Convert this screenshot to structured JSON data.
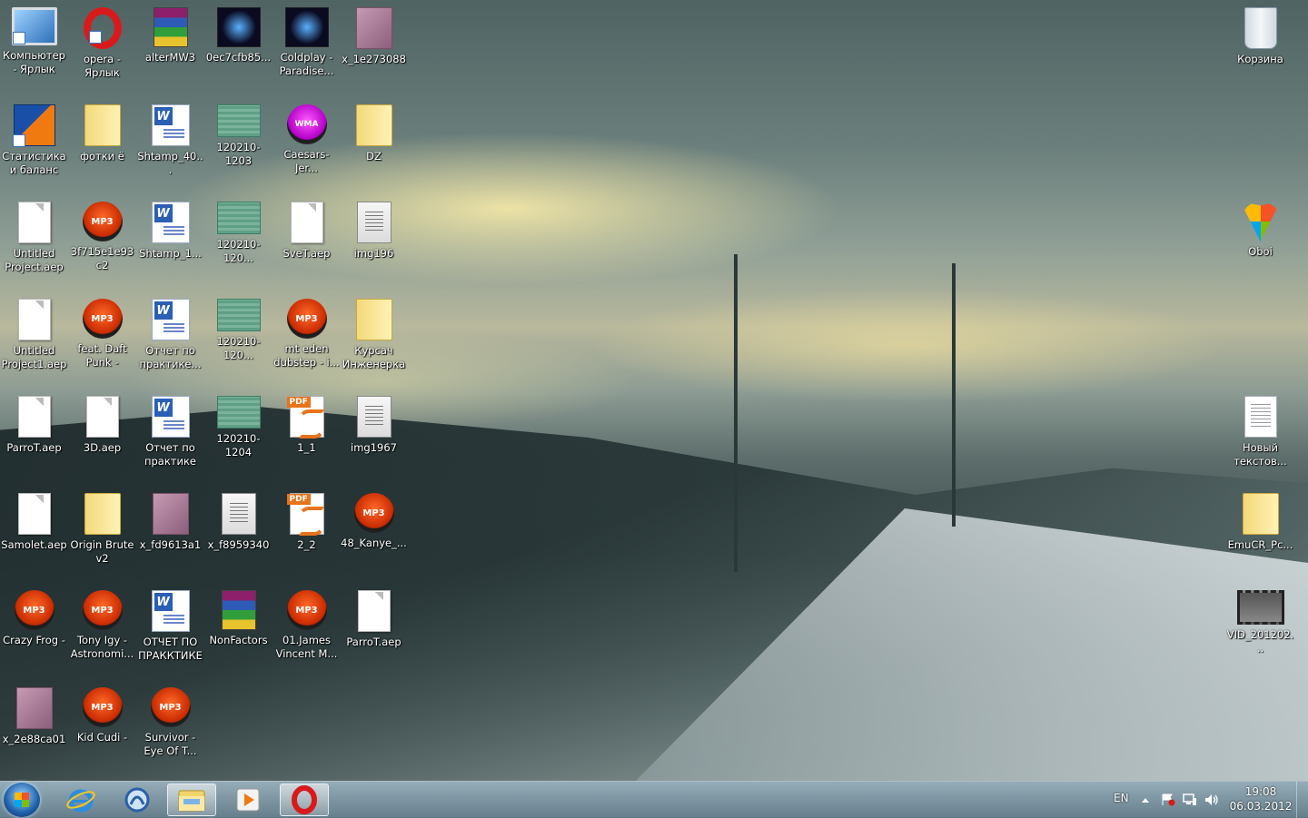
{
  "desktop": {
    "icons": [
      {
        "label": "Компьютер - Ярлык",
        "icon": "computer-icon"
      },
      {
        "label": "opera - Ярлык",
        "icon": "opera-icon"
      },
      {
        "label": "alterMW3",
        "icon": "winrar-icon"
      },
      {
        "label": "0ec7cfb85...",
        "icon": "media-file-icon"
      },
      {
        "label": "Coldplay - Paradise...",
        "icon": "media-file-icon"
      },
      {
        "label": "x_1e273088",
        "icon": "photo-icon"
      },
      {
        "label": "Статистика и баланс",
        "icon": "statistics-icon"
      },
      {
        "label": "фотки ё",
        "icon": "folder-icon"
      },
      {
        "label": "Shtamp_40...",
        "icon": "word-doc-icon"
      },
      {
        "label": "120210-1203",
        "icon": "excel-sheet-icon"
      },
      {
        "label": "Caesars-Jer...",
        "icon": "wma-icon"
      },
      {
        "label": "DZ",
        "icon": "folder-icon"
      },
      {
        "label": "Untitled Project.aep",
        "icon": "blank-file-icon"
      },
      {
        "label": "3f715e1e93c2",
        "icon": "mp3-icon"
      },
      {
        "label": "Shtamp_1...",
        "icon": "word-doc-icon"
      },
      {
        "label": "120210-120...",
        "icon": "excel-sheet-icon"
      },
      {
        "label": "SveT.aep",
        "icon": "blank-file-icon"
      },
      {
        "label": "img196",
        "icon": "scan-image-icon"
      },
      {
        "label": "Untitled Project1.aep",
        "icon": "blank-file-icon"
      },
      {
        "label": "feat. Daft Punk -",
        "icon": "mp3-icon"
      },
      {
        "label": "Отчет по практике...",
        "icon": "word-doc-icon"
      },
      {
        "label": "120210-120...",
        "icon": "excel-sheet-icon"
      },
      {
        "label": "mt eden dubstep - i...",
        "icon": "mp3-icon"
      },
      {
        "label": "Курсач Инженерка",
        "icon": "folder-icon"
      },
      {
        "label": "ParroT.aep",
        "icon": "blank-file-icon"
      },
      {
        "label": "3D.aep",
        "icon": "blank-file-icon"
      },
      {
        "label": "Отчет по практике",
        "icon": "word-doc-icon"
      },
      {
        "label": "120210-1204",
        "icon": "excel-sheet-icon"
      },
      {
        "label": "1_1",
        "icon": "pdf-icon"
      },
      {
        "label": "img1967",
        "icon": "scan-image-icon"
      },
      {
        "label": "Samolet.aep",
        "icon": "blank-file-icon"
      },
      {
        "label": "Origin Brute v2",
        "icon": "folder-icon"
      },
      {
        "label": "x_fd9613a1",
        "icon": "photo-icon"
      },
      {
        "label": "x_f8959340",
        "icon": "scan-image-icon"
      },
      {
        "label": "2_2",
        "icon": "pdf-icon"
      },
      {
        "label": "48_Kanye_...",
        "icon": "mp3-icon"
      },
      {
        "label": "Crazy Frog -",
        "icon": "mp3-icon"
      },
      {
        "label": "Tony Igy - Astronomi...",
        "icon": "mp3-icon"
      },
      {
        "label": "ОТЧЕТ ПО ПРАККТИКЕ",
        "icon": "word-doc-icon"
      },
      {
        "label": "NonFactors",
        "icon": "winrar-icon"
      },
      {
        "label": "01.James Vincent M...",
        "icon": "mp3-icon"
      },
      {
        "label": "ParroT.aep",
        "icon": "blank-file-icon"
      },
      {
        "label": "x_2e88ca01",
        "icon": "photo-icon"
      },
      {
        "label": "Kid Cudi -",
        "icon": "mp3-icon"
      },
      {
        "label": "Survivor - Eye Of T...",
        "icon": "mp3-icon"
      },
      {
        "label": "Корзина",
        "icon": "recycle-bin-icon"
      },
      {
        "label": "Oboi",
        "icon": "oboi-icon"
      },
      {
        "label": "Новый текстов...",
        "icon": "text-file-icon"
      },
      {
        "label": "EmuCR_Pc...",
        "icon": "folder-icon"
      },
      {
        "label": "VID_201202...",
        "icon": "video-file-icon"
      }
    ]
  },
  "glyph_text": {
    "mp3": "MP3",
    "wma": "WMA",
    "pdf": "PDF",
    "word": "W"
  },
  "taskbar": {
    "start_icon": "windows-start-icon",
    "pinned": [
      {
        "name": "internet-explorer-icon"
      },
      {
        "name": "windows-live-icon"
      },
      {
        "name": "explorer-folder-icon"
      },
      {
        "name": "media-player-icon"
      },
      {
        "name": "opera-icon"
      }
    ],
    "language": "EN",
    "time": "19:08",
    "date": "06.03.2012"
  },
  "colors": {
    "taskbar": "#7f98a8",
    "mp3_accent": "#e8480c",
    "opera_red": "#d91a1a"
  }
}
